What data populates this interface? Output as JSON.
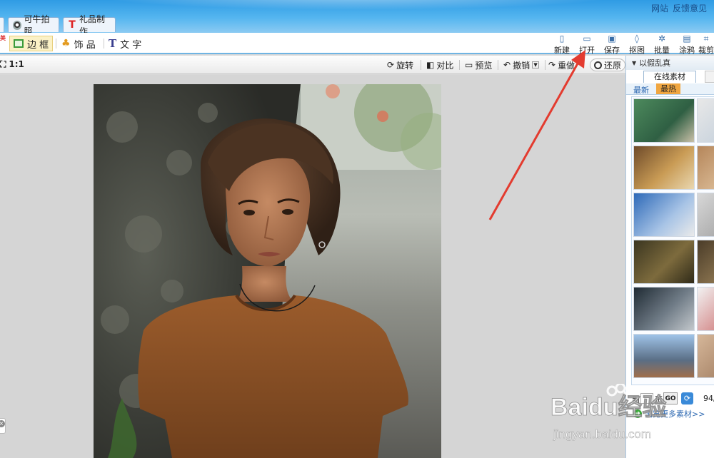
{
  "top": {
    "links": [
      "网站",
      "反馈意见"
    ],
    "tabs": [
      {
        "label": "",
        "icon": "tab-icon"
      },
      {
        "label": "可牛拍照",
        "icon": "webcam-icon"
      },
      {
        "label": "礼品制作",
        "icon": "gift-icon"
      }
    ]
  },
  "toolbar": {
    "partial_label": "美",
    "border_label": "边 框",
    "deco_label": "饰 品",
    "text_label": "文 字",
    "right": [
      {
        "label": "新建",
        "icon": "new-file-icon"
      },
      {
        "label": "打开",
        "icon": "open-folder-icon"
      },
      {
        "label": "保存",
        "icon": "save-icon"
      },
      {
        "label": "抠图",
        "icon": "cutout-icon"
      },
      {
        "label": "批量",
        "icon": "batch-gear-icon"
      },
      {
        "label": "涂鸦",
        "icon": "doodle-icon"
      },
      {
        "label": "裁剪",
        "icon": "crop-icon"
      }
    ]
  },
  "subbar": {
    "zoom_label": "1:1",
    "rotate": "旋转",
    "compare": "对比",
    "preview": "预览",
    "undo": "撤销",
    "redo": "重做",
    "restore": "还原"
  },
  "panel": {
    "header": "以假乱真",
    "tab_online": "在线素材",
    "subtab_new": "最新",
    "subtab_hot": "最热",
    "pager_prefix": "到",
    "pager_unit": "页",
    "pager_go": "GO",
    "page_info": "94/",
    "more_link": "浏览更多素材>>"
  },
  "watermark": {
    "brand": "Baidu经验",
    "url": "jingyan.baidu.com"
  },
  "colors": {
    "accent_blue": "#3e97dc",
    "arrow_red": "#e33b2f",
    "hot_tab": "#f0a640",
    "shirt_brown": "#8a5128"
  }
}
